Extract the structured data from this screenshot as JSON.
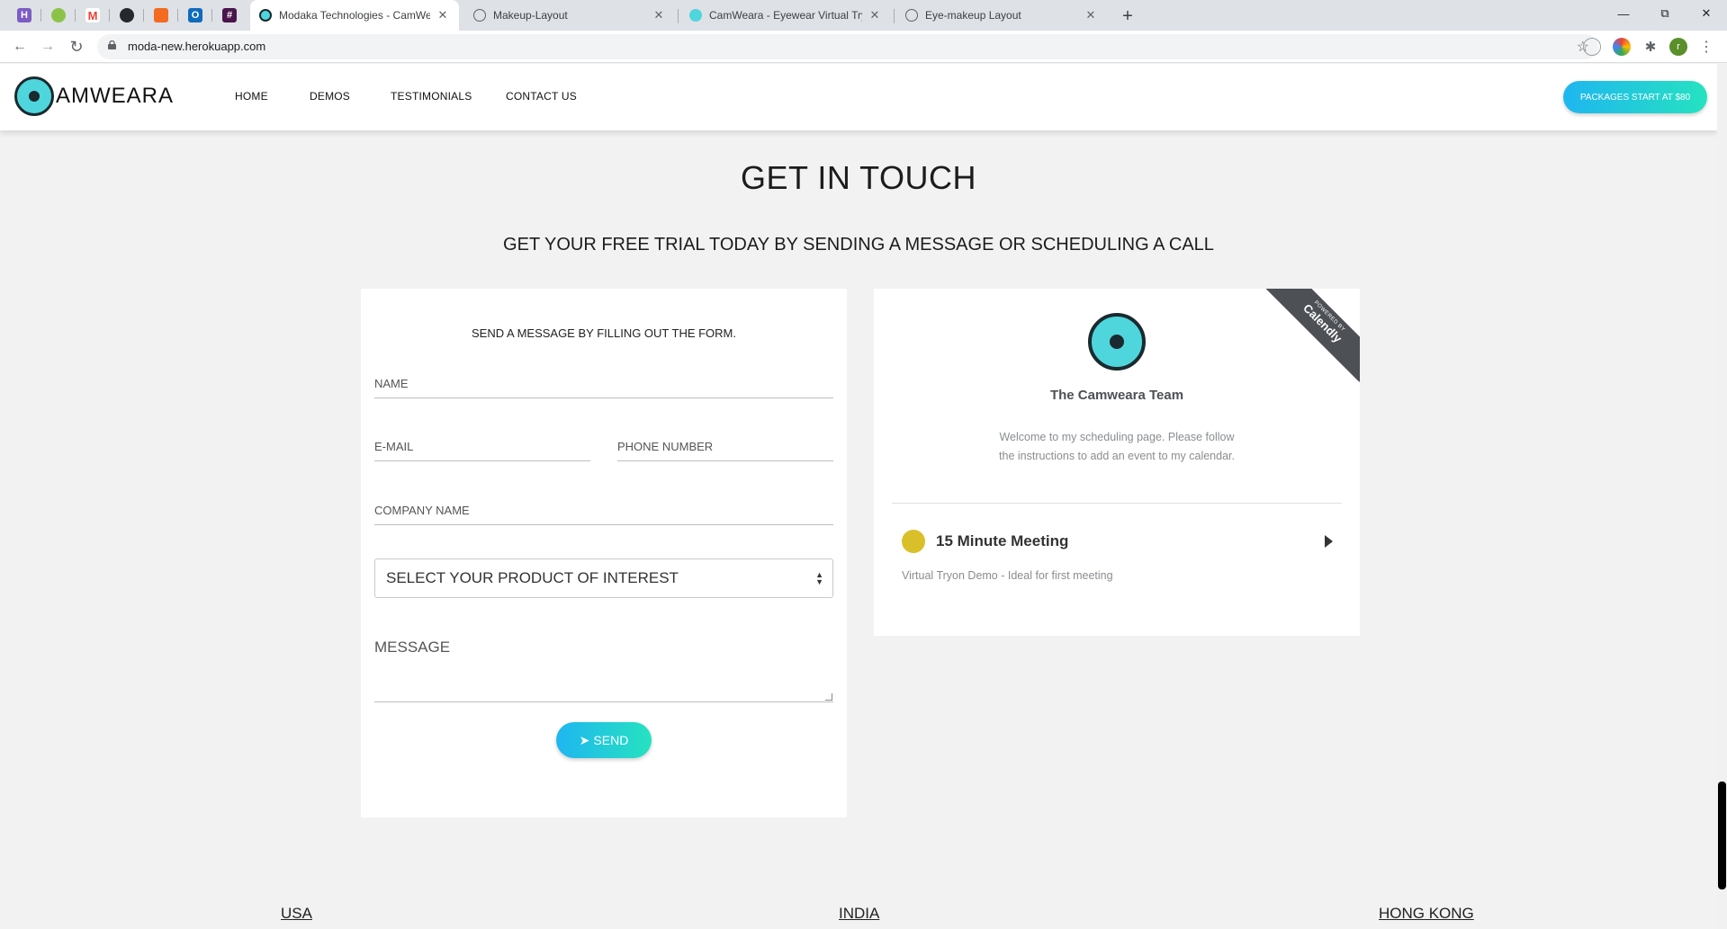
{
  "browser": {
    "pinned_tabs": [
      {
        "icon": "h-icon",
        "letter": "H",
        "color": "#7c5cc4"
      },
      {
        "icon": "leaf-icon",
        "letter": "",
        "color": "#8bc34a"
      },
      {
        "icon": "gmail-icon",
        "letter": "M",
        "color": "#ea4335"
      },
      {
        "icon": "github-icon",
        "letter": "",
        "color": "#24292e"
      },
      {
        "icon": "orange-app-icon",
        "letter": "",
        "color": "#f26b21"
      },
      {
        "icon": "outlook-icon",
        "letter": "O",
        "color": "#0f6cbd"
      },
      {
        "icon": "slack-icon",
        "letter": "#",
        "color": "#4a154b"
      }
    ],
    "tabs": [
      {
        "title": "Modaka Technologies - CamWea",
        "active": true
      },
      {
        "title": "Makeup-Layout",
        "active": false
      },
      {
        "title": "CamWeara - Eyewear Virtual Try",
        "active": false
      },
      {
        "title": "Eye-makeup Layout",
        "active": false
      }
    ],
    "close_glyph": "✕",
    "new_tab_glyph": "+",
    "url": "moda-new.herokuapp.com",
    "profile_letter": "r"
  },
  "header": {
    "logo_text": "AMWEARA",
    "nav": [
      "HOME",
      "DEMOS",
      "TESTIMONIALS",
      "CONTACT US"
    ],
    "cta": "PACKAGES START AT $80"
  },
  "main": {
    "title": "GET IN TOUCH",
    "subtitle": "GET YOUR FREE TRIAL TODAY BY SENDING A MESSAGE OR SCHEDULING A CALL"
  },
  "form": {
    "intro": "SEND A MESSAGE BY FILLING OUT THE FORM.",
    "name_placeholder": "NAME",
    "email_placeholder": "E-MAIL",
    "phone_placeholder": "PHONE NUMBER",
    "company_placeholder": "COMPANY NAME",
    "product_select": "SELECT YOUR PRODUCT OF INTEREST",
    "message_placeholder": "MESSAGE",
    "send_label": "SEND"
  },
  "calendly": {
    "ribbon_small": "POWERED BY",
    "ribbon_big": "Calendly",
    "team_name": "The Camweara Team",
    "welcome": "Welcome to my scheduling page. Please follow the instructions to add an event to my calendar.",
    "event_name": "15 Minute Meeting",
    "event_desc": "Virtual Tryon Demo - Ideal for first meeting",
    "event_color": "#d9c02a"
  },
  "footer": {
    "locations": [
      "USA",
      "INDIA",
      "HONG KONG"
    ]
  },
  "colors": {
    "accent_gradient_start": "#1fb6f0",
    "accent_gradient_end": "#26e2c0",
    "brand_teal": "#4fd6dc"
  }
}
